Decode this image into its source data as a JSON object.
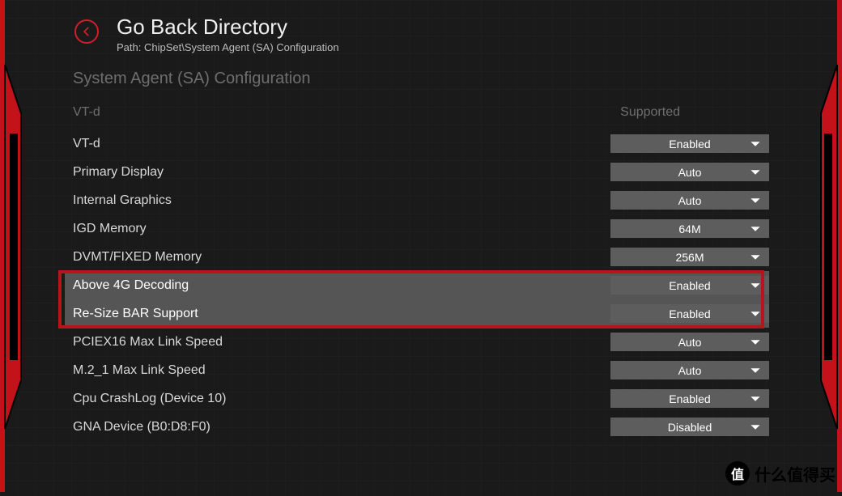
{
  "header": {
    "title": "Go Back Directory",
    "path": "Path: ChipSet\\System Agent (SA) Configuration"
  },
  "section_title": "System Agent (SA) Configuration",
  "status": {
    "label": "VT-d",
    "value": "Supported"
  },
  "settings": [
    {
      "label": "VT-d",
      "value": "Enabled",
      "highlighted": false
    },
    {
      "label": "Primary Display",
      "value": "Auto",
      "highlighted": false
    },
    {
      "label": "Internal Graphics",
      "value": "Auto",
      "highlighted": false
    },
    {
      "label": "IGD Memory",
      "value": "64M",
      "highlighted": false
    },
    {
      "label": "DVMT/FIXED Memory",
      "value": "256M",
      "highlighted": false
    },
    {
      "label": "Above 4G Decoding",
      "value": "Enabled",
      "highlighted": true
    },
    {
      "label": "Re-Size BAR Support",
      "value": "Enabled",
      "highlighted": true
    },
    {
      "label": "PCIEX16 Max Link Speed",
      "value": "Auto",
      "highlighted": false
    },
    {
      "label": "M.2_1 Max Link Speed",
      "value": "Auto",
      "highlighted": false
    },
    {
      "label": "Cpu CrashLog (Device 10)",
      "value": "Enabled",
      "highlighted": false
    },
    {
      "label": "GNA Device (B0:D8:F0)",
      "value": "Disabled",
      "highlighted": false
    }
  ],
  "watermark": {
    "badge": "值",
    "text": "什么值得买"
  }
}
